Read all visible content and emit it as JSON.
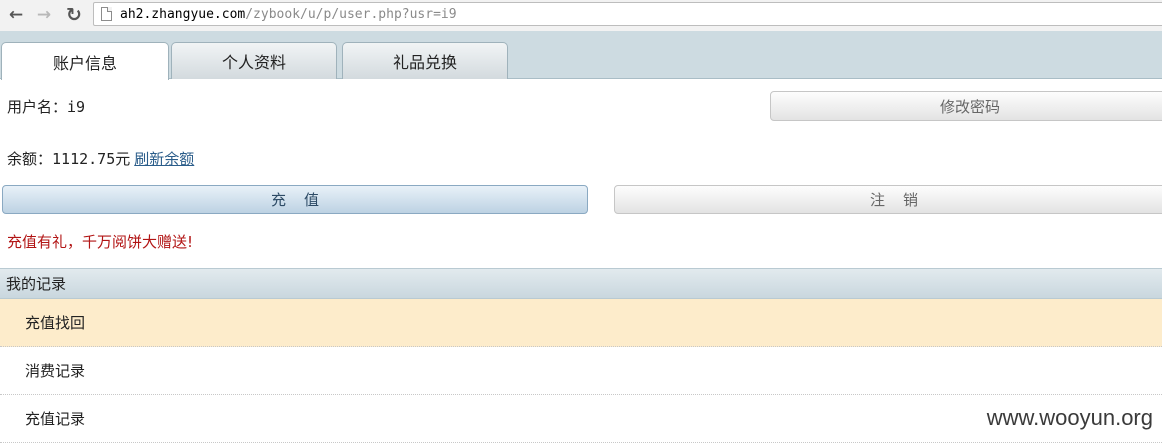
{
  "browser": {
    "url_host": "ah2.zhangyue.com",
    "url_path": "/zybook/u/p/user.php?usr=i9",
    "back_icon": "arrow-left",
    "forward_icon": "arrow-right",
    "reload_icon": "reload"
  },
  "tabs": [
    {
      "label": "账户信息",
      "active": true
    },
    {
      "label": "个人资料",
      "active": false
    },
    {
      "label": "礼品兑换",
      "active": false
    }
  ],
  "account": {
    "username_label": "用户名：",
    "username": "i9",
    "change_password": "修改密码",
    "balance_label": "余额：",
    "balance_value": "1112.75元",
    "refresh_balance": "刷新余额",
    "recharge": "充值",
    "logout": "注销",
    "promo": "充值有礼，千万阅饼大赠送!"
  },
  "records": {
    "title": "我的记录",
    "items": [
      {
        "label": "充值找回"
      },
      {
        "label": "消费记录"
      },
      {
        "label": "充值记录"
      }
    ]
  },
  "watermark": "www.wooyun.org",
  "colors": {
    "tab_bar": "#cddbe1",
    "promo_text": "#b21414",
    "link": "#2b5d8a",
    "highlight_row": "#fdeccb",
    "recharge_button": "#bdd2e3"
  }
}
